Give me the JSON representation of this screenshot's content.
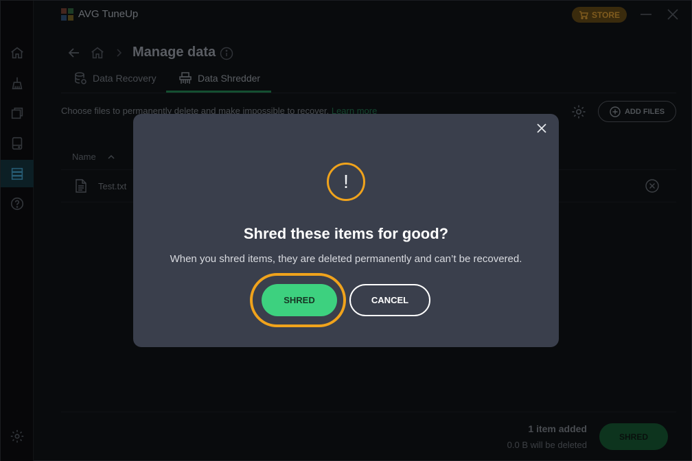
{
  "app": {
    "title": "AVG TuneUp",
    "store_label": "STORE"
  },
  "colors": {
    "accent_green": "#3dd17f",
    "warning_orange": "#f0a31c",
    "dialog_bg": "#3a3f4c"
  },
  "sidebar": {
    "items": [
      {
        "icon": "home-icon"
      },
      {
        "icon": "broom-icon"
      },
      {
        "icon": "windows-icon"
      },
      {
        "icon": "drive-icon"
      },
      {
        "icon": "data-icon",
        "active": true
      },
      {
        "icon": "help-icon"
      }
    ],
    "bottom_icon": "settings-icon"
  },
  "header": {
    "title": "Manage data"
  },
  "tabs": [
    {
      "label": "Data Recovery",
      "icon": "database-icon"
    },
    {
      "label": "Data Shredder",
      "icon": "shredder-icon",
      "active": true
    }
  ],
  "main": {
    "description": "Choose files to permanently delete and make impossible to recover.",
    "learn_more": "Learn more",
    "add_files_label": "ADD FILES",
    "column_name": "Name",
    "files": [
      {
        "name": "Test.txt"
      }
    ],
    "footer": {
      "items_added": "1 item added",
      "will_be_deleted": "0.0 B will be deleted",
      "shred_label": "SHRED"
    }
  },
  "dialog": {
    "icon_glyph": "!",
    "title": "Shred these items for good?",
    "message": "When you shred items, they are deleted permanently and can’t be recovered.",
    "shred_label": "SHRED",
    "cancel_label": "CANCEL"
  }
}
